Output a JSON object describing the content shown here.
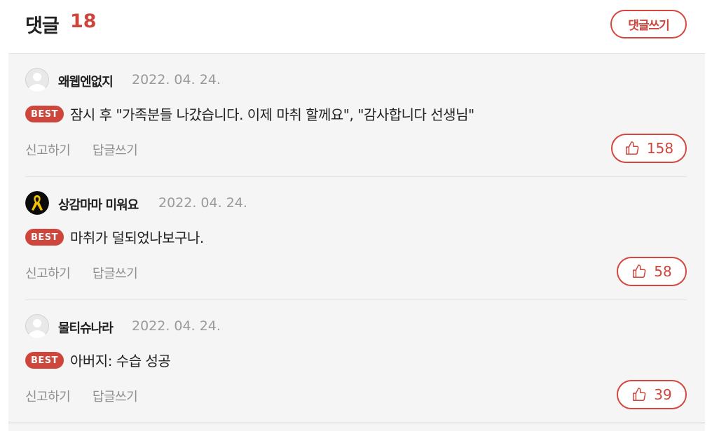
{
  "header": {
    "title": "댓글",
    "count": "18",
    "write_label": "댓글쓰기"
  },
  "colors": {
    "accent": "#d0453b",
    "panel_background": "#f5f5f5",
    "muted_text": "#8e8e8e"
  },
  "comments": [
    {
      "avatar_icon": "default-user-icon",
      "author": "왜웹엔없지",
      "date": "2022. 04. 24.",
      "badge": "BEST",
      "text": "잠시 후 \"가족분들 나갔습니다. 이제 마취 할께요\", \"감사합니다 선생님\"",
      "report_label": "신고하기",
      "reply_label": "답글쓰기",
      "like_icon": "thumbs-up-icon",
      "likes": "158"
    },
    {
      "avatar_icon": "yellow-ribbon-icon",
      "author": "상감마마 미워요",
      "date": "2022. 04. 24.",
      "badge": "BEST",
      "text": "마취가 덜되었나보구나.",
      "report_label": "신고하기",
      "reply_label": "답글쓰기",
      "like_icon": "thumbs-up-icon",
      "likes": "58"
    },
    {
      "avatar_icon": "default-user-icon",
      "author": "물티슈나라",
      "date": "2022. 04. 24.",
      "badge": "BEST",
      "text": "아버지: 수습 성공",
      "report_label": "신고하기",
      "reply_label": "답글쓰기",
      "like_icon": "thumbs-up-icon",
      "likes": "39"
    }
  ]
}
